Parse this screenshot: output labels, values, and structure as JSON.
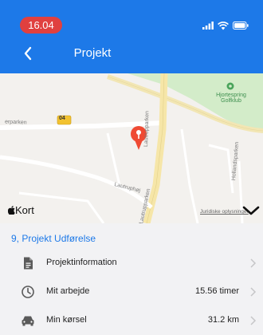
{
  "status_bar": {
    "time": "16.04",
    "signal_icon": "signal-icon",
    "wifi_icon": "wifi-icon",
    "battery_icon": "battery-icon"
  },
  "nav": {
    "title": "Projekt",
    "back_icon": "chevron-left-icon"
  },
  "map": {
    "labels": [
      "04",
      "erparken",
      "Hjortespring Golfklub",
      "Lautrupparken",
      "Lautruphøj",
      "Hollandsparken",
      "Lautrupparken"
    ],
    "attribution": "Kort",
    "legal": "Juridiske oplysninger",
    "collapse_icon": "chevron-down-icon"
  },
  "project": {
    "title": "9, Projekt Udførelse",
    "rows": [
      {
        "label": "Projektinformation",
        "value": "",
        "icon": "document-icon"
      },
      {
        "label": "Mit arbejde",
        "value": "15.56 timer",
        "icon": "clock-icon"
      },
      {
        "label": "Min kørsel",
        "value": "31.2 km",
        "icon": "car-icon"
      }
    ]
  },
  "colors": {
    "accent": "#1d79e8",
    "time_pill": "#e0403f",
    "map_pin": "#ef4a33"
  }
}
